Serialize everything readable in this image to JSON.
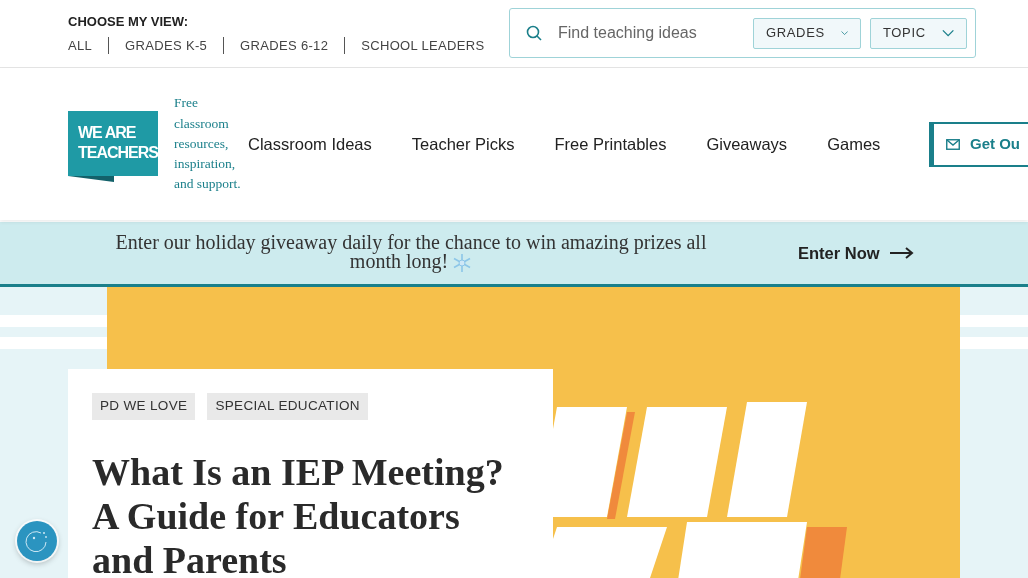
{
  "view_chooser": {
    "label": "CHOOSE MY VIEW:",
    "options": [
      {
        "label": "ALL",
        "selected": false
      },
      {
        "label": "GRADES K-5",
        "selected": false
      },
      {
        "label": "GRADES 6-12",
        "selected": false
      },
      {
        "label": "SCHOOL LEADERS",
        "selected": false
      }
    ]
  },
  "search": {
    "placeholder": "Find teaching ideas",
    "filters": [
      "GRADES",
      "TOPIC"
    ]
  },
  "logo": {
    "lines": [
      "WE ARE",
      "TEACHERS"
    ],
    "tagline": "Free classroom resources, inspiration, and support."
  },
  "nav": [
    "Classroom Ideas",
    "Teacher Picks",
    "Free Printables",
    "Giveaways",
    "Games"
  ],
  "nav_button": "Get Ou",
  "banner": {
    "text": "Enter our holiday giveaway daily for the chance to win amazing prizes all month long!",
    "link": "Enter Now"
  },
  "article": {
    "tags": [
      "PD WE LOVE",
      "SPECIAL EDUCATION"
    ],
    "title": "What Is an IEP Meeting? A Guide for Educators and Parents"
  }
}
